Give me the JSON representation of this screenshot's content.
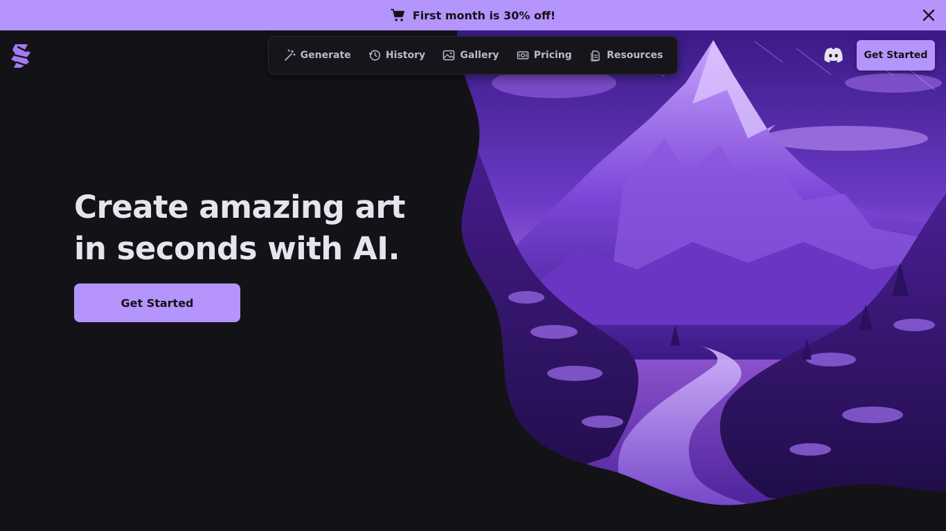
{
  "promo": {
    "icon": "cart-icon",
    "text": "First month is 30% off!",
    "close_icon": "close-icon",
    "background": "#b594fb"
  },
  "brand": {
    "logo_icon": "logo-icon",
    "accent_color": "#b594fb"
  },
  "nav": {
    "items": [
      {
        "label": "Generate",
        "icon": "magic-wand-icon"
      },
      {
        "label": "History",
        "icon": "history-icon"
      },
      {
        "label": "Gallery",
        "icon": "image-icon"
      },
      {
        "label": "Pricing",
        "icon": "money-icon"
      },
      {
        "label": "Resources",
        "icon": "document-icon"
      }
    ]
  },
  "header": {
    "discord_icon": "discord-icon",
    "get_started_label": "Get Started"
  },
  "hero": {
    "headline_line1": "Create amazing art",
    "headline_line2": "in seconds with AI.",
    "cta_label": "Get Started",
    "image": "purple-mountain-path-illustration"
  }
}
